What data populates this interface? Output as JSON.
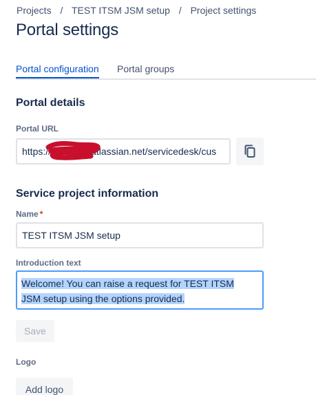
{
  "breadcrumb": {
    "items": [
      "Projects",
      "TEST ITSM JSM setup",
      "Project settings"
    ],
    "separator": "/"
  },
  "page": {
    "title": "Portal settings"
  },
  "tabs": [
    {
      "label": "Portal configuration",
      "active": true
    },
    {
      "label": "Portal groups",
      "active": false
    }
  ],
  "portal_details": {
    "title": "Portal details",
    "url_label": "Portal URL",
    "url_value_prefix": "https://",
    "url_value_suffix": "atlassian.net/servicedesk/cus",
    "copy_icon": "copy-icon"
  },
  "service_project": {
    "title": "Service project information",
    "name_label": "Name",
    "required_marker": "*",
    "name_value": "TEST ITSM JSM setup",
    "intro_label": "Introduction text",
    "intro_line1": "Welcome! You can raise a request for TEST ITSM",
    "intro_line2": "JSM setup using the options provided.",
    "save_label": "Save"
  },
  "logo": {
    "label": "Logo",
    "add_label": "Add logo"
  },
  "colors": {
    "primary": "#0052cc",
    "focus_border": "#4c9aff",
    "selection": "#b3d4ff",
    "required": "#de350b",
    "redaction": "#c8102e"
  }
}
